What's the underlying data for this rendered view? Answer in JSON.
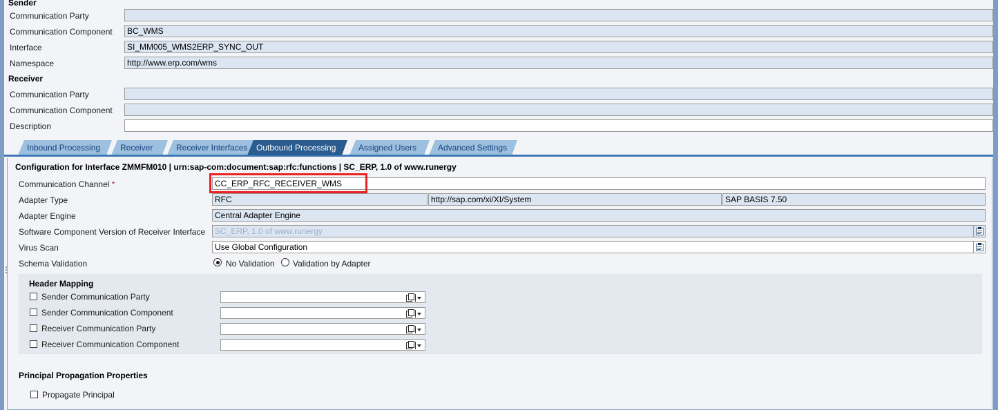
{
  "window": {
    "left_rail_color": "#7f9dc4",
    "panel_bg": "#f2f4f7"
  },
  "sender": {
    "heading": "Sender",
    "rows": [
      {
        "label": "Communication Party",
        "value": "",
        "readonly": true
      },
      {
        "label": "Communication Component",
        "value": "BC_WMS",
        "readonly": true
      },
      {
        "label": "Interface",
        "value": "SI_MM005_WMS2ERP_SYNC_OUT",
        "readonly": true
      },
      {
        "label": "Namespace",
        "value": "http://www.erp.com/wms",
        "readonly": true
      }
    ]
  },
  "receiver": {
    "heading": "Receiver",
    "rows": [
      {
        "label": "Communication Party",
        "value": "",
        "readonly": true
      },
      {
        "label": "Communication Component",
        "value": "",
        "readonly": true
      },
      {
        "label": "Description",
        "value": "",
        "readonly": false
      }
    ]
  },
  "tabs": [
    {
      "label": "Inbound Processing",
      "active": false
    },
    {
      "label": "Receiver",
      "active": false
    },
    {
      "label": "Receiver Interfaces",
      "active": false
    },
    {
      "label": "Outbound Processing",
      "active": true
    },
    {
      "label": "Assigned Users",
      "active": false
    },
    {
      "label": "Advanced Settings",
      "active": false
    }
  ],
  "config": {
    "title": "Configuration for Interface ZMMFM010 | urn:sap-com:document:sap:rfc:functions | SC_ERP, 1.0 of www.runergy",
    "communication_channel": {
      "label": "Communication Channel",
      "required_marker": "*",
      "value": "CC_ERP_RFC_RECEIVER_WMS",
      "highlighted": true,
      "highlight_color": "#ef2020"
    },
    "adapter_type": {
      "label": "Adapter Type",
      "value": "RFC",
      "namespace": "http://sap.com/xi/XI/System",
      "swcv": "SAP BASIS 7.50"
    },
    "adapter_engine": {
      "label": "Adapter Engine",
      "value": "Central Adapter Engine"
    },
    "software_component_version": {
      "label": "Software Component Version of Receiver Interface",
      "value": "SC_ERP, 1.0 of www.runergy",
      "disabled": true
    },
    "virus_scan": {
      "label": "Virus Scan",
      "value": "Use Global Configuration"
    },
    "schema_validation": {
      "label": "Schema Validation",
      "options": [
        {
          "label": "No Validation",
          "selected": true
        },
        {
          "label": "Validation by Adapter",
          "selected": false
        }
      ]
    }
  },
  "header_mapping": {
    "title": "Header Mapping",
    "rows": [
      {
        "label": "Sender Communication Party",
        "checked": false,
        "value": ""
      },
      {
        "label": "Sender Communication Component",
        "checked": false,
        "value": ""
      },
      {
        "label": "Receiver Communication Party",
        "checked": false,
        "value": ""
      },
      {
        "label": "Receiver Communication Component",
        "checked": false,
        "value": ""
      }
    ]
  },
  "principal_propagation": {
    "title": "Principal Propagation Properties",
    "checkbox": {
      "label": "Propagate Principal",
      "checked": false
    }
  }
}
